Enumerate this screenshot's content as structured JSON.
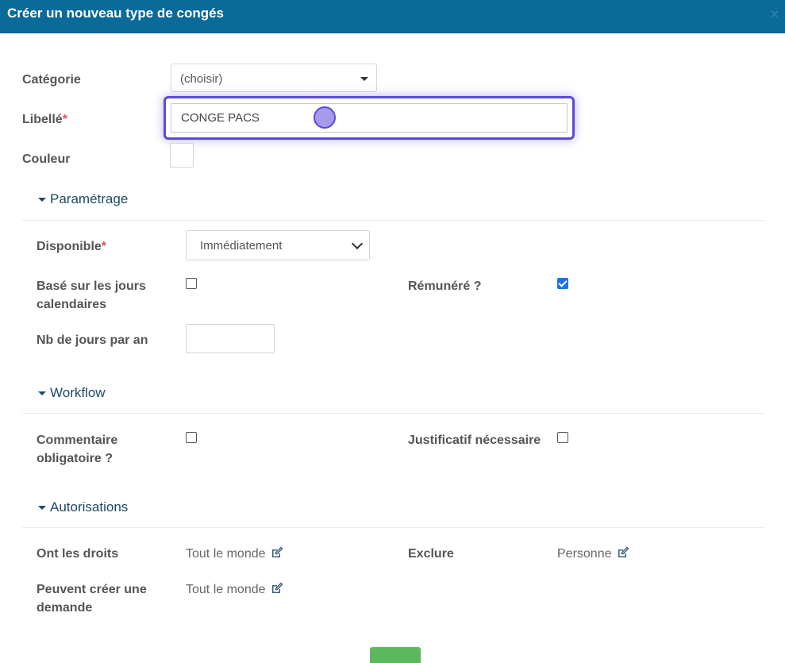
{
  "dialog": {
    "title": "Créer un nouveau type de congés",
    "close": "×"
  },
  "form": {
    "categorie_label": "Catégorie",
    "categorie_value": "(choisir)",
    "libelle_label": "Libellé",
    "required_mark": "*",
    "libelle_value": "CONGE PACS",
    "couleur_label": "Couleur"
  },
  "parametrage": {
    "heading": "Paramétrage",
    "disponible_label": "Disponible",
    "disponible_value": "Immédiatement",
    "jours_calendaires_label_line1": "Basé sur les jours",
    "jours_calendaires_label_line2": "calendaires",
    "jours_calendaires_checked": false,
    "remunere_label": "Rémunéré ?",
    "remunere_checked": true,
    "nb_jours_label": "Nb de jours par an"
  },
  "workflow": {
    "heading": "Workflow",
    "commentaire_label_line1": "Commentaire",
    "commentaire_label_line2": "obligatoire ?",
    "commentaire_checked": false,
    "justificatif_label": "Justificatif nécessaire",
    "justificatif_checked": false
  },
  "autorisations": {
    "heading": "Autorisations",
    "droits_label": "Ont les droits",
    "droits_value": "Tout le monde",
    "exclure_label": "Exclure",
    "exclure_value": "Personne",
    "creer_label_line1": "Peuvent créer une",
    "creer_label_line2": "demande",
    "creer_value": "Tout le monde"
  },
  "colors": {
    "header": "#0a6a99",
    "accent": "#5a4bd6",
    "checkbox": "#1a73e8",
    "save": "#5cb85c"
  },
  "icons": {
    "edit": "edit-icon",
    "close": "close-icon",
    "caret": "caret-down-icon"
  }
}
